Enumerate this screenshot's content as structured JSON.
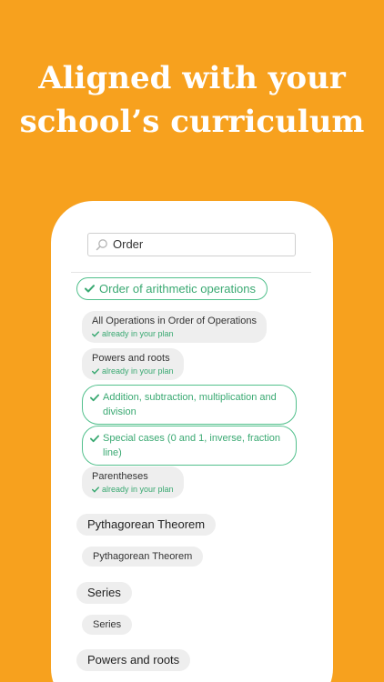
{
  "headline": {
    "line1": "Aligned with your",
    "line2": "school’s curriculum"
  },
  "search": {
    "value": "Order",
    "icon": "search-icon"
  },
  "colors": {
    "background": "#F7A11E",
    "accent_green": "#3aa972",
    "chip_gray": "#eeeeee"
  },
  "selected_topic": {
    "label": "Order of arithmetic operations"
  },
  "subtopics": [
    {
      "label": "All Operations in Order of Operations",
      "status": "already in your plan"
    },
    {
      "label": "Powers and roots",
      "status": "already in your plan"
    },
    {
      "label": "Addition, subtraction, multiplication and division"
    },
    {
      "label": "Special cases (0 and 1, inverse, fraction line)"
    },
    {
      "label": "Parentheses",
      "status": "already in your plan"
    }
  ],
  "topics": [
    {
      "label": "Pythagorean Theorem",
      "sub": "Pythagorean Theorem"
    },
    {
      "label": "Series",
      "sub": "Series"
    },
    {
      "label": "Powers and roots"
    }
  ]
}
